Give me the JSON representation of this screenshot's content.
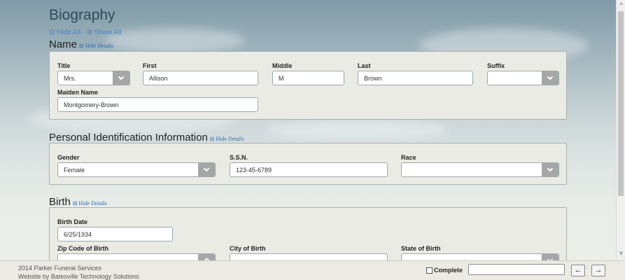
{
  "page": {
    "title": "Biography",
    "hide_all": "⊟ Hide All",
    "show_all": "⊞ Show All"
  },
  "sections": {
    "name": {
      "title": "Name",
      "hide": "⊟ Hide Details",
      "title_label": "Title",
      "title_value": "Mrs.",
      "first_label": "First",
      "first_value": "Allison",
      "middle_label": "Middle",
      "middle_value": "M",
      "last_label": "Last",
      "last_value": "Brown",
      "suffix_label": "Suffix",
      "suffix_value": "",
      "maiden_label": "Maiden Name",
      "maiden_value": "Montgomery-Brown"
    },
    "pii": {
      "title": "Personal Identification Information",
      "hide": "⊟ Hide Details",
      "gender_label": "Gender",
      "gender_value": "Female",
      "ssn_label": "S.S.N.",
      "ssn_value": "123-45-6789",
      "race_label": "Race",
      "race_value": ""
    },
    "birth": {
      "title": "Birth",
      "hide": "⊟ Hide Details",
      "date_label": "Birth Date",
      "date_value": "6/25/1934",
      "zip_label": "Zip Code of Birth",
      "city_label": "City of Birth",
      "state_label": "State of Birth"
    }
  },
  "footer": {
    "company": "2014 Parker Funeral Services",
    "credit": "Website by Batesville Technology Solutions",
    "complete_label": "Complete",
    "prev": "←",
    "next": "→"
  },
  "scroll": {
    "up": "^",
    "down": "v"
  },
  "colors": {
    "accent_link": "#2a6bb0",
    "panel_bg": "#ebebe5",
    "select_button": "#a4a7a6"
  }
}
